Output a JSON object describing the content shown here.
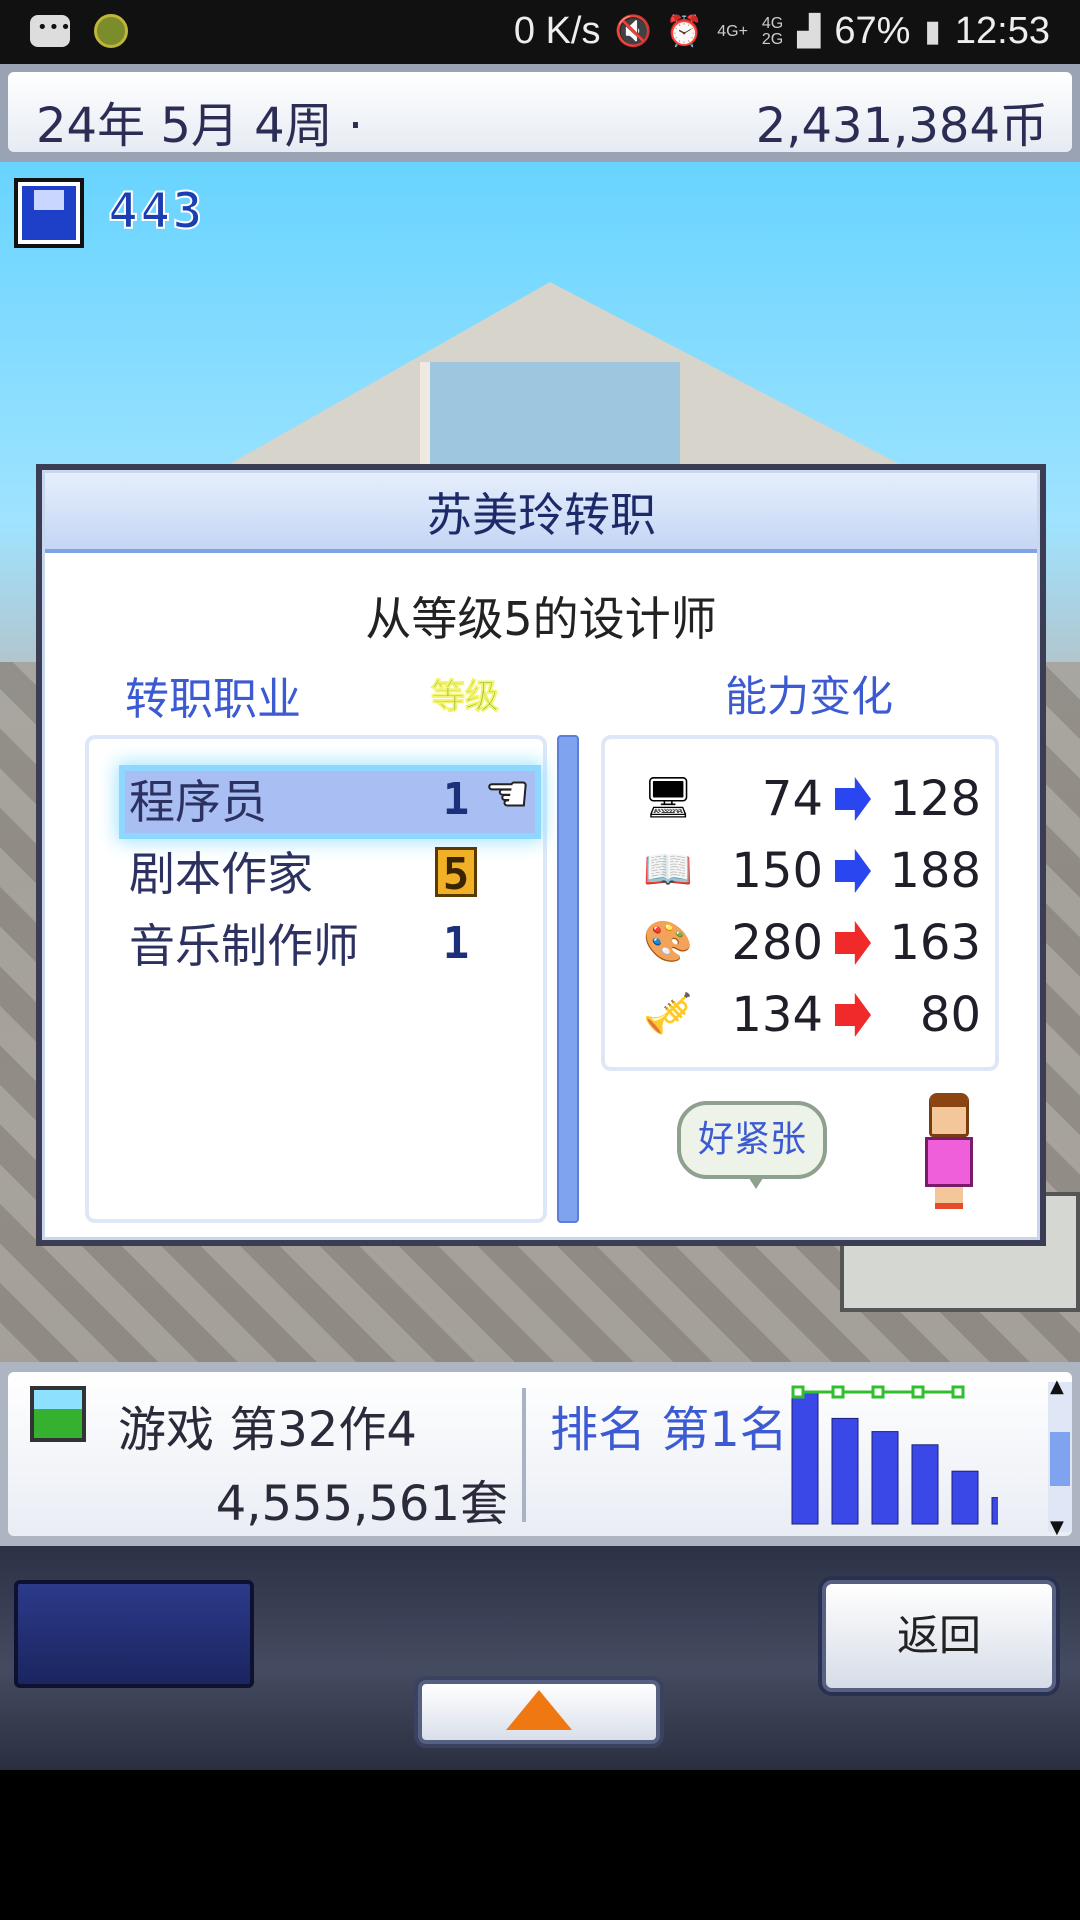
{
  "status_bar": {
    "net_speed": "0 K/s",
    "net_4g": "4G+",
    "net_4g2": "4G",
    "net_2g": "2G",
    "battery": "67%",
    "time": "12:53"
  },
  "top_bar": {
    "date": "24年 5月 4周 ·",
    "money": "2,431,384币"
  },
  "save_count": "443",
  "dialog": {
    "title": "苏美玲转职",
    "subtitle": "从等级5的设计师",
    "header_job": "转职职业",
    "header_level": "等级",
    "header_ability": "能力变化",
    "jobs": [
      {
        "name": "程序员",
        "level": "1",
        "selected": true
      },
      {
        "name": "剧本作家",
        "level": "5",
        "selected": false
      },
      {
        "name": "音乐制作师",
        "level": "1",
        "selected": false
      }
    ],
    "abilities": [
      {
        "icon": "computer-icon",
        "from": "74",
        "to": "128",
        "direction": "up",
        "color": "#2946f0"
      },
      {
        "icon": "book-pen-icon",
        "from": "150",
        "to": "188",
        "direction": "up",
        "color": "#2946f0"
      },
      {
        "icon": "paint-palette-icon",
        "from": "280",
        "to": "163",
        "direction": "down",
        "color": "#f02a2a"
      },
      {
        "icon": "trumpet-icon",
        "from": "134",
        "to": "80",
        "direction": "down",
        "color": "#f02a2a"
      }
    ],
    "speech_bubble": "好紧张"
  },
  "info_panel": {
    "game_title": "游戏 第32作4",
    "sales": "4,555,561套",
    "rank": "排名 第1名"
  },
  "controls": {
    "back_label": "返回"
  },
  "chart_data": {
    "type": "bar",
    "values": [
      10,
      8,
      7,
      6,
      4,
      2
    ],
    "note_line": [
      10,
      10,
      10,
      10,
      10
    ],
    "bar_color": "#3b48e8",
    "line_color": "#2fbf2f"
  }
}
